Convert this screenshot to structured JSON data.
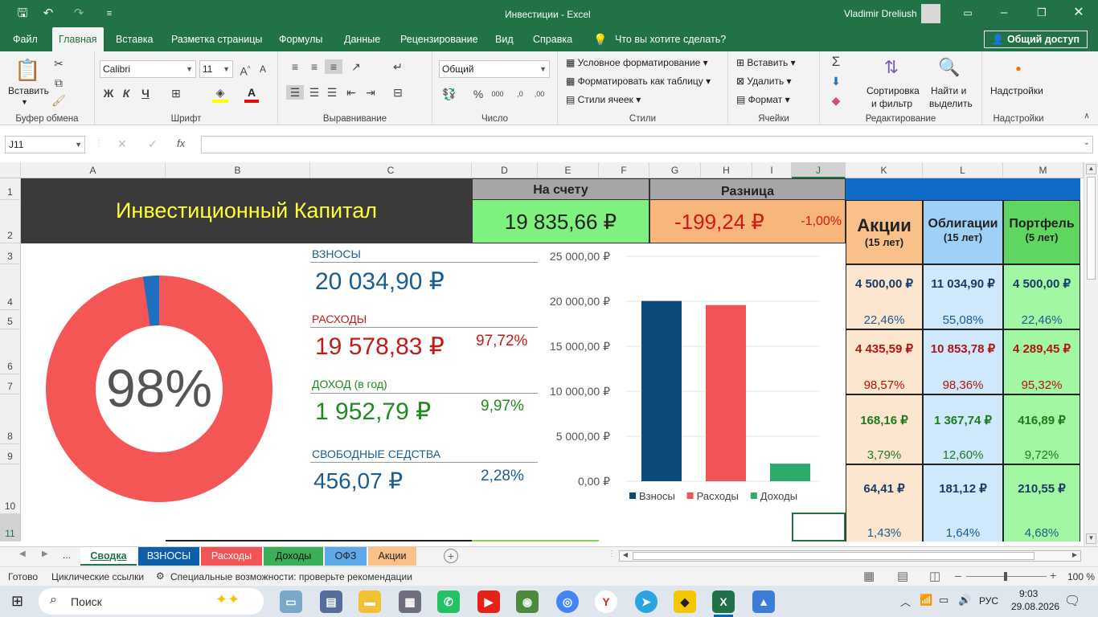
{
  "window": {
    "title": "Инвестиции  -  Excel",
    "user": "Vladimir Dreliush"
  },
  "ribbon_tabs": [
    {
      "label": "Файл"
    },
    {
      "label": "Главная"
    },
    {
      "label": "Вставка"
    },
    {
      "label": "Разметка страницы"
    },
    {
      "label": "Формулы"
    },
    {
      "label": "Данные"
    },
    {
      "label": "Рецензирование"
    },
    {
      "label": "Вид"
    },
    {
      "label": "Справка"
    },
    {
      "label": "Что вы хотите сделать?"
    }
  ],
  "share_label": "Общий доступ",
  "ribbon": {
    "clipboard": {
      "paste": "Вставить",
      "group": "Буфер обмена"
    },
    "font": {
      "name": "Calibri",
      "size": "11",
      "group": "Шрифт",
      "bold": "Ж",
      "italic": "К",
      "underline": "Ч"
    },
    "alignment": {
      "group": "Выравнивание"
    },
    "number": {
      "format": "Общий",
      "group": "Число"
    },
    "styles": {
      "cond": "Условное форматирование",
      "table": "Форматировать как таблицу",
      "cell": "Стили ячеек",
      "group": "Стили"
    },
    "cells": {
      "insert": "Вставить",
      "delete": "Удалить",
      "format": "Формат",
      "group": "Ячейки"
    },
    "editing": {
      "sort1": "Сортировка",
      "sort2": "и фильтр",
      "find1": "Найти и",
      "find2": "выделить",
      "group": "Редактирование"
    },
    "addins": {
      "label": "Надстройки",
      "group": "Надстройки"
    }
  },
  "formula_bar": {
    "name_box": "J11",
    "value": ""
  },
  "columns": [
    "A",
    "B",
    "C",
    "D",
    "E",
    "F",
    "G",
    "H",
    "I",
    "J",
    "K",
    "L",
    "M"
  ],
  "rows": [
    "1",
    "2",
    "3",
    "4",
    "5",
    "6",
    "7",
    "8",
    "9",
    "10",
    "11"
  ],
  "sheet": {
    "title": "Инвестиционный Капитал",
    "balance_label": "На счету",
    "balance": "19 835,66 ₽",
    "diff_label": "Разница",
    "diff": "-199,24 ₽",
    "diff_pct": "-1,00%",
    "donut_pct": "98%",
    "donut_fill": 0.9772,
    "contrib_label": "ВЗНОСЫ",
    "contrib": "20 034,90 ₽",
    "expense_label": "РАСХОДЫ",
    "expense": "19 578,83 ₽",
    "expense_pct": "97,72%",
    "income_label": "ДОХОД (в год)",
    "income": "1 952,79 ₽",
    "income_pct": "9,97%",
    "free_label": "СВОБОДНЫЕ СЕДСТВА",
    "free": "456,07 ₽",
    "free_pct": "2,28%"
  },
  "portfolio": {
    "headers": [
      {
        "name": "Акции",
        "sub": "(15 лет)"
      },
      {
        "name": "Облигации",
        "sub": "(15 лет)"
      },
      {
        "name": "Портфель",
        "sub": "(5 лет)"
      }
    ],
    "rows": [
      {
        "cells": [
          {
            "value": "4 500,00 ₽",
            "pct": "22,46%"
          },
          {
            "value": "11 034,90 ₽",
            "pct": "55,08%"
          },
          {
            "value": "4 500,00 ₽",
            "pct": "22,46%"
          }
        ]
      },
      {
        "cells": [
          {
            "value": "4 435,59 ₽",
            "pct": "98,57%"
          },
          {
            "value": "10 853,78 ₽",
            "pct": "98,36%"
          },
          {
            "value": "4 289,45 ₽",
            "pct": "95,32%"
          }
        ]
      },
      {
        "cells": [
          {
            "value": "168,16 ₽",
            "pct": "3,79%"
          },
          {
            "value": "1 367,74 ₽",
            "pct": "12,60%"
          },
          {
            "value": "416,89 ₽",
            "pct": "9,72%"
          }
        ]
      },
      {
        "cells": [
          {
            "value": "64,41 ₽",
            "pct": "1,43%"
          },
          {
            "value": "181,12 ₽",
            "pct": "1,64%"
          },
          {
            "value": "210,55 ₽",
            "pct": "4,68%"
          }
        ]
      }
    ]
  },
  "chart_data": {
    "type": "bar",
    "categories": [
      "Взносы",
      "Расходы",
      "Доходы"
    ],
    "values": [
      20034.9,
      19578.83,
      1952.79
    ],
    "colors": [
      "#0b4a7a",
      "#f05454",
      "#2eaa6a"
    ],
    "yticks": [
      "0,00 ₽",
      "5 000,00 ₽",
      "10 000,00 ₽",
      "15 000,00 ₽",
      "20 000,00 ₽",
      "25 000,00 ₽"
    ],
    "ylim": [
      0,
      25000
    ],
    "legend": "bottom",
    "grid": true
  },
  "sheet_tabs": [
    {
      "label": "Сводка",
      "color": "#ffffff"
    },
    {
      "label": "ВЗНОСЫ",
      "color": "#0f5fa8"
    },
    {
      "label": "Расходы",
      "color": "#f05454"
    },
    {
      "label": "Доходы",
      "color": "#3cae58"
    },
    {
      "label": "ОФЗ",
      "color": "#5ea9e8"
    },
    {
      "label": "Акции",
      "color": "#f9c08a"
    }
  ],
  "status": {
    "ready": "Готово",
    "circular": "Циклические ссылки",
    "accessibility": "Специальные возможности: проверьте рекомендации",
    "zoom": "100 %"
  },
  "taskbar": {
    "search": "Поиск",
    "lang": "РУС",
    "time": "9:03",
    "date": "29.08.2026"
  }
}
